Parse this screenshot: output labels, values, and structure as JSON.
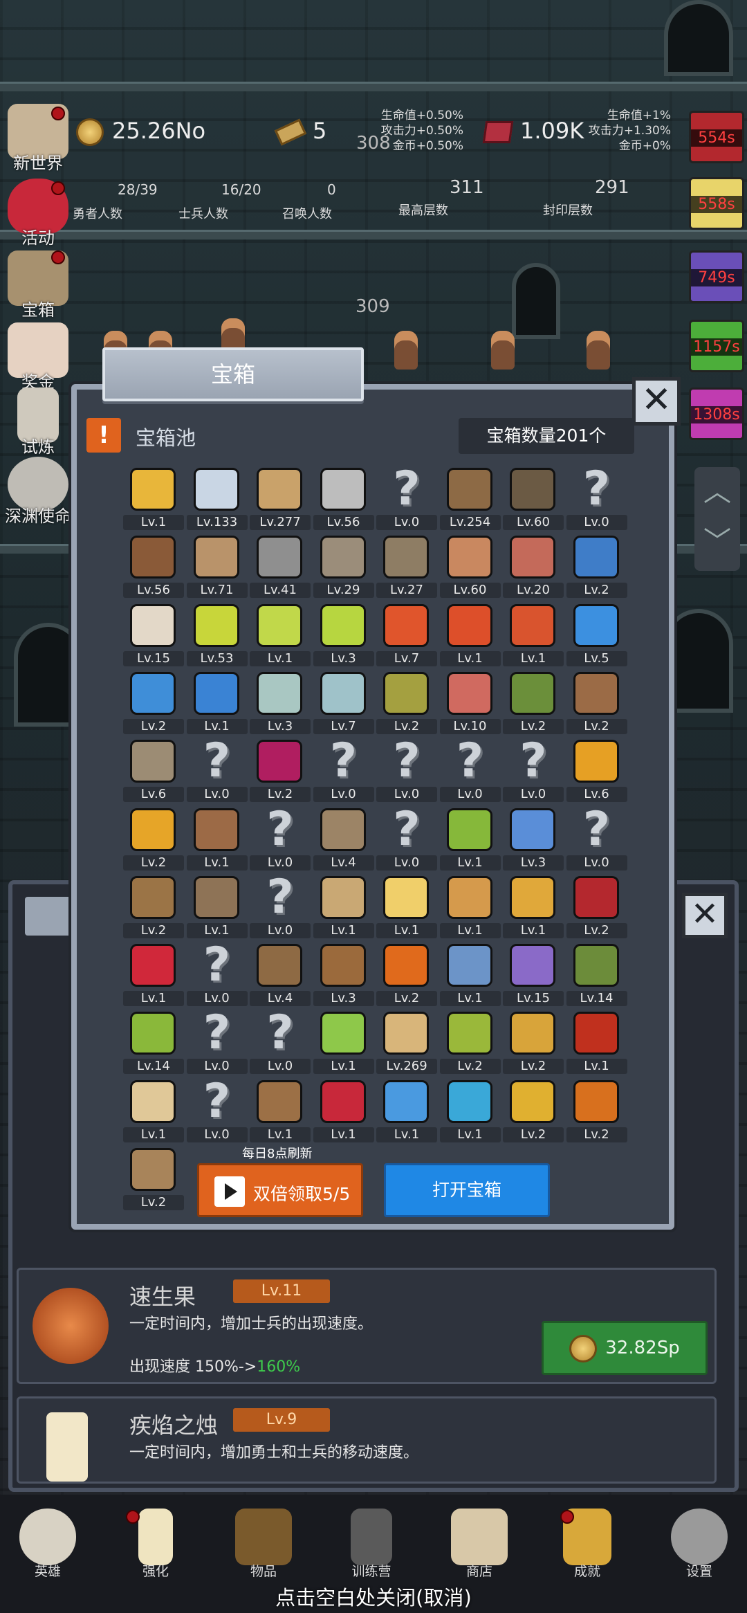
{
  "hud": {
    "gold": "25.26No",
    "bars": "5",
    "gems": "1.09K",
    "floor_current": "308",
    "floor_next": "309",
    "bonus_left": [
      "生命值+0.50%",
      "攻击力+0.50%",
      "金币+0.50%"
    ],
    "bonus_right": [
      "生命值+1%",
      "攻击力+1.30%",
      "金币+0%"
    ],
    "stats": [
      {
        "value": "28/39",
        "label": "勇者人数"
      },
      {
        "value": "16/20",
        "label": "士兵人数"
      },
      {
        "value": "0",
        "label": "召唤人数"
      },
      {
        "value": "311",
        "label": "最高层数"
      },
      {
        "value": "291",
        "label": "封印层数"
      }
    ]
  },
  "side_menu": [
    {
      "label": "新世界",
      "icon": "map-scroll-icon"
    },
    {
      "label": "活动",
      "icon": "heart-icon"
    },
    {
      "label": "宝箱",
      "icon": "chest-icon"
    },
    {
      "label": "奖金",
      "icon": "envelope-icon"
    },
    {
      "label": "试炼",
      "icon": "feather-icon"
    },
    {
      "label": "深渊使命",
      "icon": "moon-icon"
    }
  ],
  "timers": [
    "554s",
    "558s",
    "749s",
    "1157s",
    "1308s"
  ],
  "modal": {
    "title": "宝箱",
    "pool_label": "宝箱池",
    "chest_count": "宝箱数量201个",
    "refresh_note": "每日8点刷新",
    "double_button": "双倍领取5/5",
    "open_button": "打开宝箱",
    "items": [
      {
        "icon": "crown-icon",
        "lv": "Lv.1",
        "c": "#e8b63a"
      },
      {
        "icon": "diamond-icon",
        "lv": "Lv.133",
        "c": "#c9d6e4"
      },
      {
        "icon": "sword-icon",
        "lv": "Lv.277",
        "c": "#c9a26a"
      },
      {
        "icon": "sword-icon",
        "lv": "Lv.56",
        "c": "#bdbdbd"
      },
      {
        "icon": "unknown-icon",
        "lv": "Lv.0",
        "c": ""
      },
      {
        "icon": "armor-icon",
        "lv": "Lv.254",
        "c": "#8d6a45"
      },
      {
        "icon": "armor-icon",
        "lv": "Lv.60",
        "c": "#6b5a44"
      },
      {
        "icon": "unknown-icon",
        "lv": "Lv.0",
        "c": ""
      },
      {
        "icon": "helmet-icon",
        "lv": "Lv.56",
        "c": "#8a5a38"
      },
      {
        "icon": "sword-icon",
        "lv": "Lv.71",
        "c": "#b9936a"
      },
      {
        "icon": "helmet-icon",
        "lv": "Lv.41",
        "c": "#8f8f8f"
      },
      {
        "icon": "hammer-icon",
        "lv": "Lv.29",
        "c": "#9b8d7a"
      },
      {
        "icon": "helmet-icon",
        "lv": "Lv.27",
        "c": "#8e7d64"
      },
      {
        "icon": "meat-icon",
        "lv": "Lv.60",
        "c": "#c98860"
      },
      {
        "icon": "steak-icon",
        "lv": "Lv.20",
        "c": "#c46a5a"
      },
      {
        "icon": "bag-icon",
        "lv": "Lv.2",
        "c": "#3f7dc8"
      },
      {
        "icon": "bread-icon",
        "lv": "Lv.15",
        "c": "#e3d8c8"
      },
      {
        "icon": "potion-icon",
        "lv": "Lv.53",
        "c": "#c8d63a"
      },
      {
        "icon": "potion-icon",
        "lv": "Lv.1",
        "c": "#c1d84a"
      },
      {
        "icon": "potion-icon",
        "lv": "Lv.3",
        "c": "#b7d640"
      },
      {
        "icon": "potion-icon",
        "lv": "Lv.7",
        "c": "#e0552c"
      },
      {
        "icon": "potion-icon",
        "lv": "Lv.1",
        "c": "#dd4f2a"
      },
      {
        "icon": "potion-icon",
        "lv": "Lv.1",
        "c": "#d9542e"
      },
      {
        "icon": "potion-icon",
        "lv": "Lv.5",
        "c": "#3c90e0"
      },
      {
        "icon": "potion-icon",
        "lv": "Lv.2",
        "c": "#3f8ed8"
      },
      {
        "icon": "potion-icon",
        "lv": "Lv.1",
        "c": "#3a83d4"
      },
      {
        "icon": "bottle-icon",
        "lv": "Lv.3",
        "c": "#a9c7c2"
      },
      {
        "icon": "bottle-icon",
        "lv": "Lv.7",
        "c": "#9fc2c9"
      },
      {
        "icon": "bottle-icon",
        "lv": "Lv.2",
        "c": "#a4a040"
      },
      {
        "icon": "bottle-icon",
        "lv": "Lv.10",
        "c": "#d06a60"
      },
      {
        "icon": "boot-icon",
        "lv": "Lv.2",
        "c": "#6b8f3a"
      },
      {
        "icon": "boot-icon",
        "lv": "Lv.2",
        "c": "#9b6b46"
      },
      {
        "icon": "boot-icon",
        "lv": "Lv.6",
        "c": "#9c8c74"
      },
      {
        "icon": "unknown-icon",
        "lv": "Lv.0",
        "c": ""
      },
      {
        "icon": "boot-icon",
        "lv": "Lv.2",
        "c": "#b01e60"
      },
      {
        "icon": "unknown-icon",
        "lv": "Lv.0",
        "c": ""
      },
      {
        "icon": "unknown-icon",
        "lv": "Lv.0",
        "c": ""
      },
      {
        "icon": "unknown-icon",
        "lv": "Lv.0",
        "c": ""
      },
      {
        "icon": "unknown-icon",
        "lv": "Lv.0",
        "c": ""
      },
      {
        "icon": "torch-icon",
        "lv": "Lv.6",
        "c": "#e6a024"
      },
      {
        "icon": "torch-icon",
        "lv": "Lv.2",
        "c": "#e6a528"
      },
      {
        "icon": "mushroom-icon",
        "lv": "Lv.1",
        "c": "#9c6a46"
      },
      {
        "icon": "unknown-icon",
        "lv": "Lv.0",
        "c": ""
      },
      {
        "icon": "staff-icon",
        "lv": "Lv.4",
        "c": "#9c8466"
      },
      {
        "icon": "unknown-icon",
        "lv": "Lv.0",
        "c": ""
      },
      {
        "icon": "fruit-icon",
        "lv": "Lv.1",
        "c": "#86b83a"
      },
      {
        "icon": "wand-icon",
        "lv": "Lv.3",
        "c": "#5a8ed8"
      },
      {
        "icon": "unknown-icon",
        "lv": "Lv.0",
        "c": ""
      },
      {
        "icon": "backpack-icon",
        "lv": "Lv.2",
        "c": "#9b7446"
      },
      {
        "icon": "shovel-icon",
        "lv": "Lv.1",
        "c": "#8e7356"
      },
      {
        "icon": "unknown-icon",
        "lv": "Lv.0",
        "c": ""
      },
      {
        "icon": "broom-icon",
        "lv": "Lv.1",
        "c": "#c9a874"
      },
      {
        "icon": "cheese-icon",
        "lv": "Lv.1",
        "c": "#f0cf6a"
      },
      {
        "icon": "pie-icon",
        "lv": "Lv.1",
        "c": "#d59a4c"
      },
      {
        "icon": "jar-icon",
        "lv": "Lv.1",
        "c": "#e0a83a"
      },
      {
        "icon": "pyramid-icon",
        "lv": "Lv.2",
        "c": "#b4282e"
      },
      {
        "icon": "orb-icon",
        "lv": "Lv.1",
        "c": "#d0283a"
      },
      {
        "icon": "unknown-icon",
        "lv": "Lv.0",
        "c": ""
      },
      {
        "icon": "bow-icon",
        "lv": "Lv.4",
        "c": "#8e6a44"
      },
      {
        "icon": "quiver-icon",
        "lv": "Lv.3",
        "c": "#9b6a3c"
      },
      {
        "icon": "gauntlet-icon",
        "lv": "Lv.2",
        "c": "#e06a1c"
      },
      {
        "icon": "rune-icon",
        "lv": "Lv.1",
        "c": "#6c94c8"
      },
      {
        "icon": "rune-icon",
        "lv": "Lv.15",
        "c": "#8a6ac8"
      },
      {
        "icon": "amulet-icon",
        "lv": "Lv.14",
        "c": "#6c8c3a"
      },
      {
        "icon": "crystal-icon",
        "lv": "Lv.14",
        "c": "#8ab83a"
      },
      {
        "icon": "unknown-icon",
        "lv": "Lv.0",
        "c": ""
      },
      {
        "icon": "unknown-icon",
        "lv": "Lv.0",
        "c": ""
      },
      {
        "icon": "wand-icon",
        "lv": "Lv.1",
        "c": "#8ec84a"
      },
      {
        "icon": "mug-icon",
        "lv": "Lv.269",
        "c": "#d8b57a"
      },
      {
        "icon": "vine-icon",
        "lv": "Lv.2",
        "c": "#9ab83a"
      },
      {
        "icon": "pickaxe-icon",
        "lv": "Lv.2",
        "c": "#d8a43a"
      },
      {
        "icon": "book-icon",
        "lv": "Lv.1",
        "c": "#c0301e"
      },
      {
        "icon": "scroll-icon",
        "lv": "Lv.1",
        "c": "#e0c898"
      },
      {
        "icon": "unknown-icon",
        "lv": "Lv.0",
        "c": ""
      },
      {
        "icon": "whip-icon",
        "lv": "Lv.1",
        "c": "#9c7046"
      },
      {
        "icon": "banner-icon",
        "lv": "Lv.1",
        "c": "#c8283a"
      },
      {
        "icon": "crystal-ball-icon",
        "lv": "Lv.1",
        "c": "#4a9ae0"
      },
      {
        "icon": "shield-icon",
        "lv": "Lv.1",
        "c": "#3aa8d8"
      },
      {
        "icon": "globe-icon",
        "lv": "Lv.2",
        "c": "#e0b030"
      },
      {
        "icon": "arrow-icon",
        "lv": "Lv.2",
        "c": "#d8701e"
      },
      {
        "icon": "cage-icon",
        "lv": "Lv.2",
        "c": "#a8845a"
      }
    ]
  },
  "cards": [
    {
      "name": "速生果",
      "lv": "Lv.11",
      "desc": "一定时间内，增加士兵的出现速度。",
      "eff_prefix": "出现速度 150%->",
      "eff_new": "160%",
      "price": "32.82Sp"
    },
    {
      "name": "疾焰之烛",
      "lv": "Lv.9",
      "desc": "一定时间内，增加勇士和士兵的移动速度。"
    }
  ],
  "nav": [
    {
      "label": "英雄",
      "icon": "skull-icon"
    },
    {
      "label": "强化",
      "icon": "candle-icon"
    },
    {
      "label": "物品",
      "icon": "book-icon"
    },
    {
      "label": "训练营",
      "icon": "lantern-icon"
    },
    {
      "label": "商店",
      "icon": "mug-icon"
    },
    {
      "label": "成就",
      "icon": "key-icon"
    },
    {
      "label": "设置",
      "icon": "gear-icon"
    }
  ],
  "hint": "点击空白处关闭(取消)"
}
